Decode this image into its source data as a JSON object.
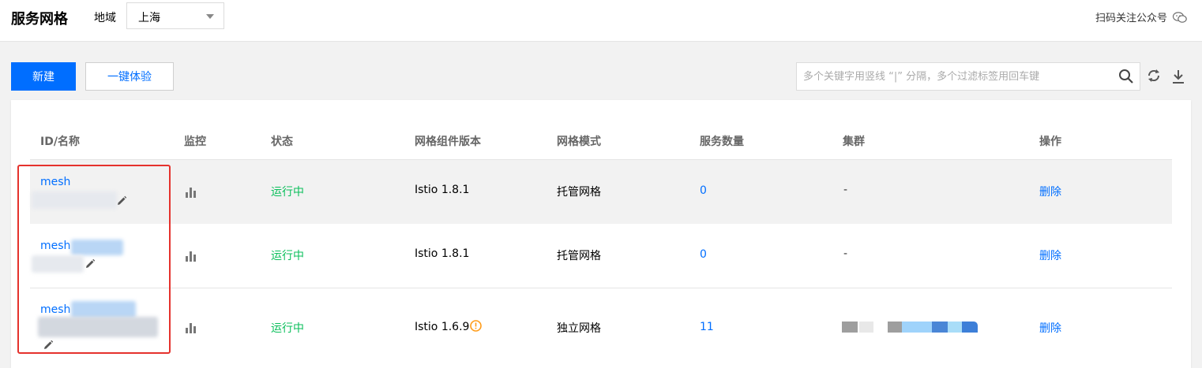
{
  "header": {
    "title": "服务网格",
    "region_label": "地域",
    "region_value": "上海",
    "follow_label": "扫码关注公众号"
  },
  "toolbar": {
    "new_label": "新建",
    "trial_label": "一键体验",
    "search_placeholder": "多个关键字用竖线 “|” 分隔，多个过滤标签用回车键"
  },
  "table": {
    "columns": [
      "ID/名称",
      "监控",
      "状态",
      "网格组件版本",
      "网格模式",
      "服务数量",
      "集群",
      "操作"
    ],
    "rows": [
      {
        "id": "mesh",
        "status": "运行中",
        "version": "Istio 1.8.1",
        "mode": "托管网格",
        "services": "0",
        "cluster": "-",
        "action": "删除"
      },
      {
        "id": "mesh",
        "status": "运行中",
        "version": "Istio 1.8.1",
        "mode": "托管网格",
        "services": "0",
        "cluster": "-",
        "action": "删除"
      },
      {
        "id": "mesh",
        "status": "运行中",
        "version": "Istio 1.6.9",
        "mode": "独立网格",
        "services": "11",
        "cluster": "",
        "action": "删除"
      }
    ]
  },
  "colors": {
    "primary": "#006eff",
    "running": "#0abf5b",
    "warning": "#ff9c19",
    "highlight": "#e5322d"
  },
  "icons": [
    "wechat-icon",
    "search-icon",
    "refresh-icon",
    "download-icon",
    "monitor-chart-icon",
    "edit-pencil-icon",
    "warning-icon"
  ]
}
